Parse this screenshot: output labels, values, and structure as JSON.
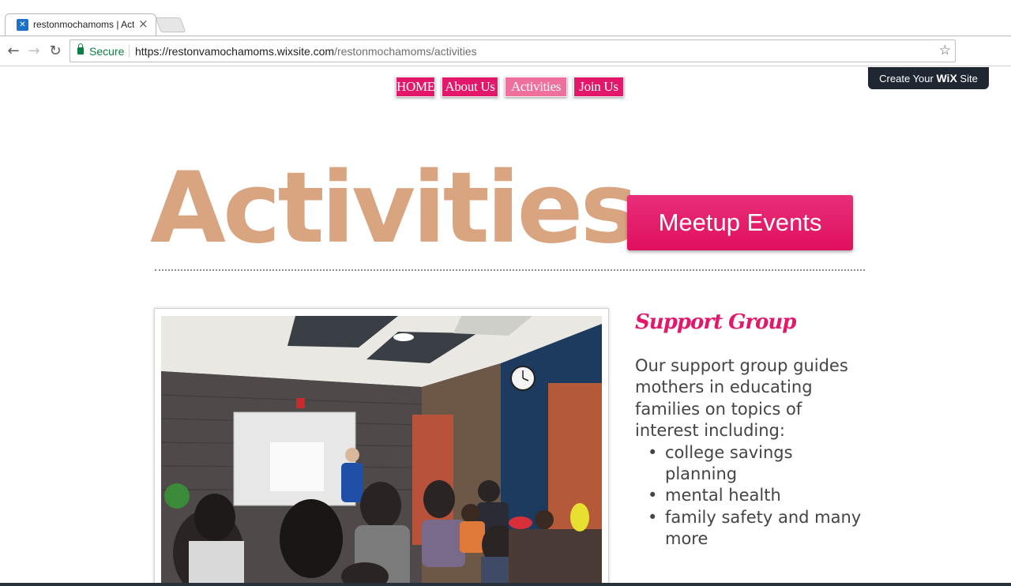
{
  "browser": {
    "tab_title": "restonmochamoms | Activities",
    "tab_close": "×",
    "secure_label": "Secure",
    "url_host": "https://restonvamochamoms.wixsite.com",
    "url_path": "/restonmochamoms/activities",
    "nav": {
      "back": "←",
      "forward": "→",
      "reload": "↻",
      "star": "☆"
    }
  },
  "wix_banner": {
    "prefix": "Create Your",
    "brand": "WiX",
    "suffix": "Site"
  },
  "menu": {
    "items": [
      {
        "label": "HOME"
      },
      {
        "label": "About Us"
      },
      {
        "label": "Activities",
        "active": true
      },
      {
        "label": "Join Us"
      }
    ]
  },
  "page": {
    "heading": "Activities",
    "meetup_button": "Meetup Events",
    "section_title": "Support Group",
    "section_intro": "Our support group guides mothers in educating families on topics of interest including:",
    "bullets": [
      "college savings planning",
      "mental health",
      "family safety and many more"
    ]
  },
  "colors": {
    "accent_pink": "#e4186a",
    "heading_tan": "#d9a581",
    "body_text": "#444444",
    "wix_banner": "#1f2733"
  }
}
